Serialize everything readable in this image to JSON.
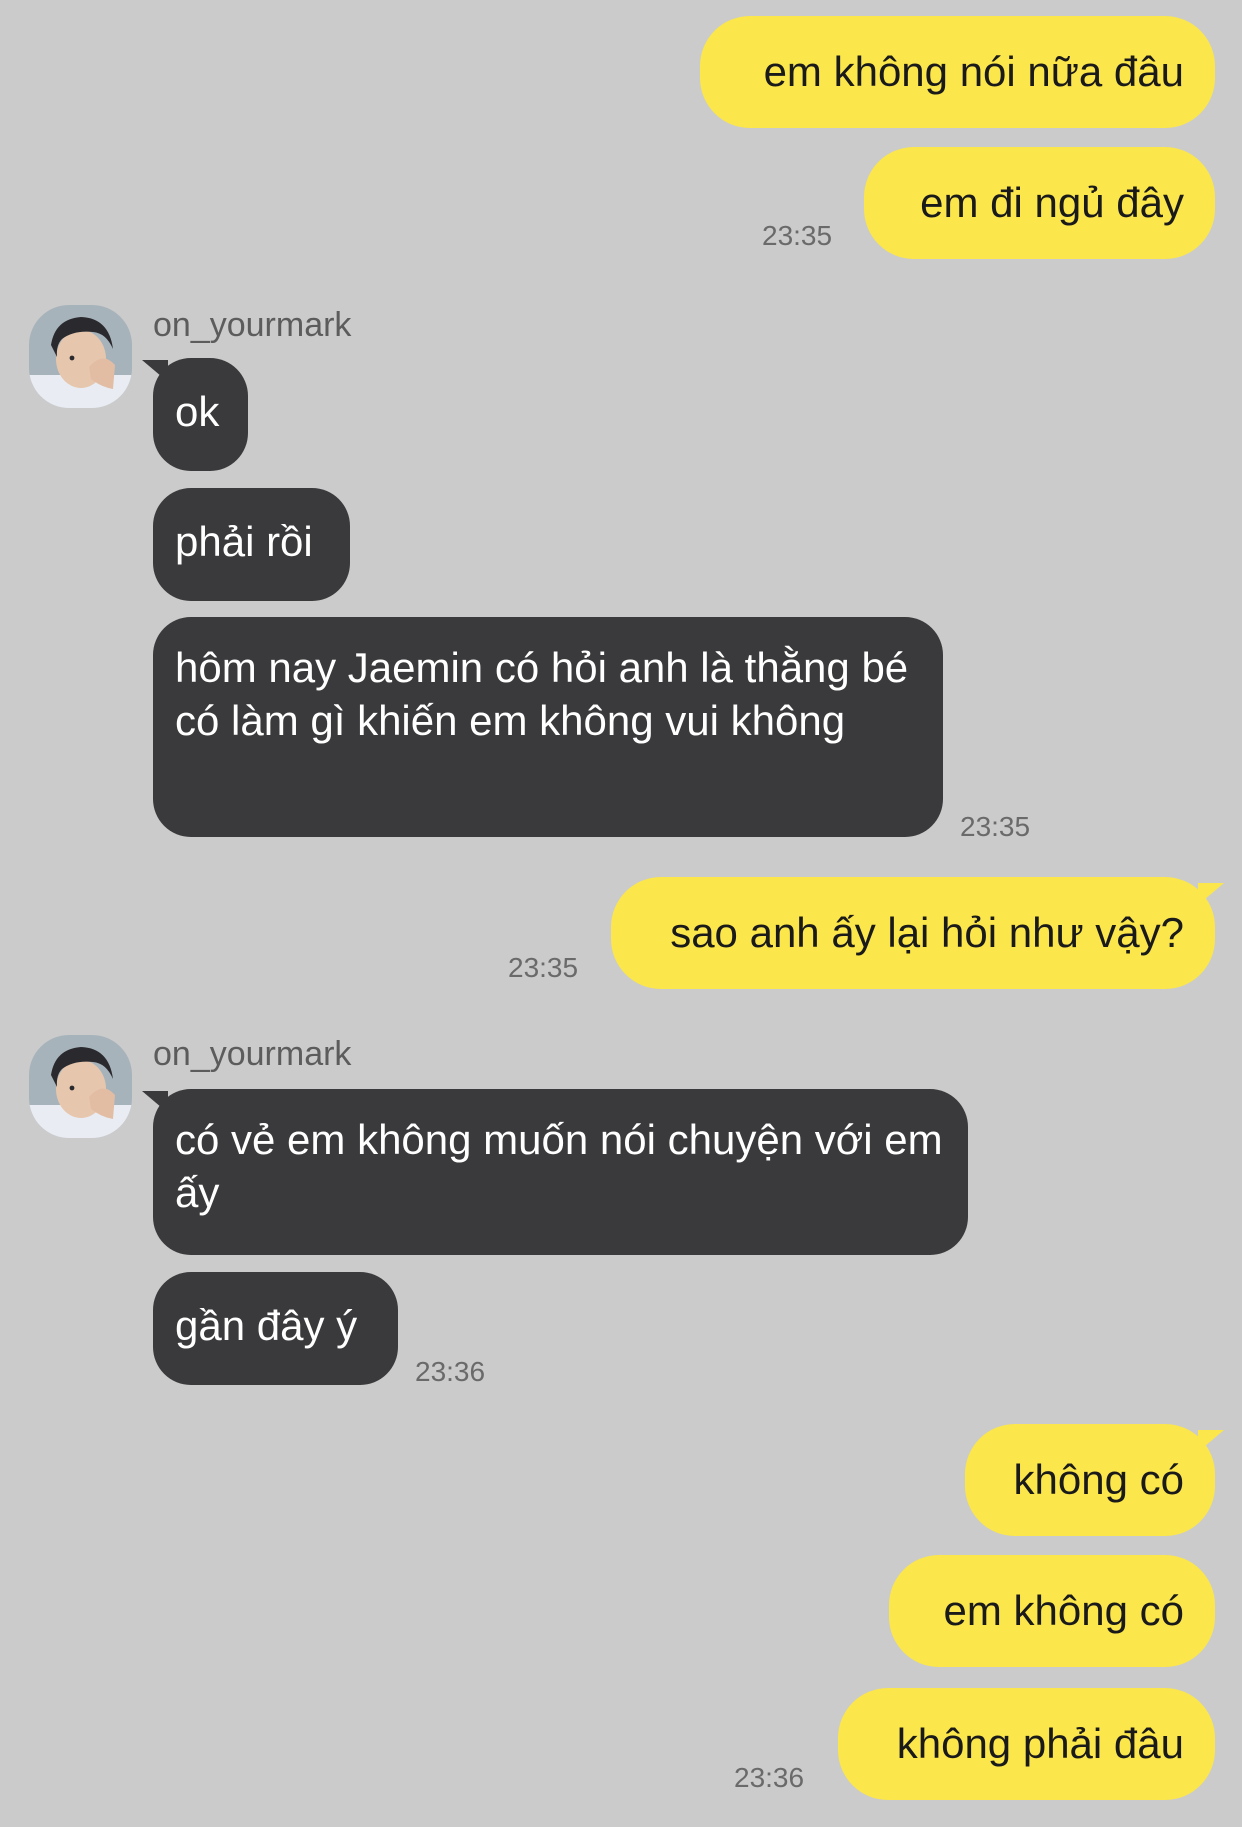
{
  "messages": {
    "m1": "em không nói nữa đâu",
    "m2": "em đi ngủ đây",
    "t1": "23:35",
    "sender1": "on_yourmark",
    "r1": "ok",
    "r2": "phải rồi",
    "r3": "hôm nay Jaemin có hỏi anh là thằng bé có làm gì khiến em không vui không",
    "t2": "23:35",
    "m3": "sao anh ấy lại hỏi như vậy?",
    "t3": "23:35",
    "sender2": "on_yourmark",
    "r4": "có vẻ em không muốn nói chuyện với em ấy",
    "r5": "gần đây ý",
    "t4": "23:36",
    "m4": "không có",
    "m5": "em không có",
    "m6": "không phải đâu",
    "t5": "23:36"
  },
  "colors": {
    "background": "#cbcbcb",
    "outgoing_bubble": "#fbe64b",
    "incoming_bubble": "#3a3a3c"
  }
}
